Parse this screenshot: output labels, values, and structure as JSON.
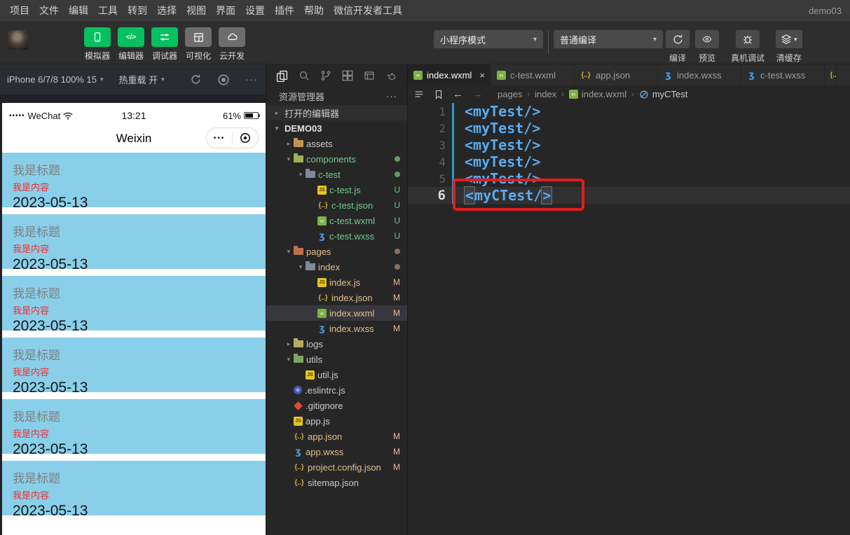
{
  "titlebar": {
    "menus": [
      "项目",
      "文件",
      "编辑",
      "工具",
      "转到",
      "选择",
      "视图",
      "界面",
      "设置",
      "插件",
      "帮助",
      "微信开发者工具"
    ],
    "project": "demo03"
  },
  "toolbar": {
    "mode_buttons": [
      {
        "label": "模拟器",
        "icon": "phone",
        "active": true
      },
      {
        "label": "编辑器",
        "icon": "code",
        "active": true
      },
      {
        "label": "调试器",
        "icon": "sliders",
        "active": true
      },
      {
        "label": "可视化",
        "icon": "grid",
        "active": false
      },
      {
        "label": "云开发",
        "icon": "cloud",
        "active": false
      }
    ],
    "mode_select": "小程序模式",
    "compile_select": "普通编译",
    "actions": [
      {
        "label": "编译",
        "icon": "refresh"
      },
      {
        "label": "预览",
        "icon": "eye"
      },
      {
        "label": "真机调试",
        "icon": "bug"
      },
      {
        "label": "清缓存",
        "icon": "layers",
        "caret": true
      }
    ]
  },
  "simulator": {
    "device": "iPhone 6/7/8 100% 15",
    "hot_reload": "热重载 开",
    "statusbar": {
      "signal": "•••••",
      "carrier": "WeChat",
      "time": "13:21",
      "battery": "61%"
    },
    "nav_title": "Weixin",
    "capsule_dots": "•••",
    "cards": [
      {
        "title": "我是标题",
        "content": "我是内容",
        "date": "2023-05-13"
      },
      {
        "title": "我是标题",
        "content": "我是内容",
        "date": "2023-05-13"
      },
      {
        "title": "我是标题",
        "content": "我是内容",
        "date": "2023-05-13"
      },
      {
        "title": "我是标题",
        "content": "我是内容",
        "date": "2023-05-13"
      },
      {
        "title": "我是标题",
        "content": "我是内容",
        "date": "2023-05-13"
      },
      {
        "title": "我是标题",
        "content": "我是内容",
        "date": "2023-05-13"
      }
    ]
  },
  "explorer": {
    "title": "资源管理器",
    "more_label": "···",
    "activity_icons": [
      "files",
      "search",
      "branch",
      "extensions",
      "package",
      "teapot"
    ],
    "tree": [
      {
        "label": "打开的编辑器",
        "indent": 0,
        "chevron": "right",
        "section": true
      },
      {
        "label": "DEMO03",
        "indent": 0,
        "chevron": "down",
        "bold": true
      },
      {
        "label": "assets",
        "indent": 1,
        "chevron": "right",
        "icon": "folder",
        "folder_color": "#c09553"
      },
      {
        "label": "components",
        "indent": 1,
        "chevron": "down",
        "icon": "folder",
        "folder_color": "#9eb156",
        "color": "untracked",
        "badge": "dot"
      },
      {
        "label": "c-test",
        "indent": 2,
        "chevron": "down",
        "icon": "folder",
        "folder_color": "#7d8a97",
        "color": "untracked",
        "badge": "dot"
      },
      {
        "label": "c-test.js",
        "indent": 3,
        "icon": "js",
        "color": "untracked",
        "badge": "U"
      },
      {
        "label": "c-test.json",
        "indent": 3,
        "icon": "json",
        "color": "untracked",
        "badge": "U"
      },
      {
        "label": "c-test.wxml",
        "indent": 3,
        "icon": "wxml",
        "color": "untracked",
        "badge": "U"
      },
      {
        "label": "c-test.wxss",
        "indent": 3,
        "icon": "wxss",
        "color": "untracked",
        "badge": "U"
      },
      {
        "label": "pages",
        "indent": 1,
        "chevron": "down",
        "icon": "folder",
        "folder_color": "#c0704f",
        "color": "modified",
        "badge": "dot"
      },
      {
        "label": "index",
        "indent": 2,
        "chevron": "down",
        "icon": "folder",
        "folder_color": "#7d8a97",
        "color": "modified",
        "badge": "dot"
      },
      {
        "label": "index.js",
        "indent": 3,
        "icon": "js",
        "color": "modified",
        "badge": "M"
      },
      {
        "label": "index.json",
        "indent": 3,
        "icon": "json",
        "color": "modified",
        "badge": "M"
      },
      {
        "label": "index.wxml",
        "indent": 3,
        "icon": "wxml",
        "color": "modified",
        "badge": "M",
        "selected": true
      },
      {
        "label": "index.wxss",
        "indent": 3,
        "icon": "wxss",
        "color": "modified",
        "badge": "M"
      },
      {
        "label": "logs",
        "indent": 1,
        "chevron": "right",
        "icon": "folder",
        "folder_color": "#b3ae62"
      },
      {
        "label": "utils",
        "indent": 1,
        "chevron": "down",
        "icon": "folder",
        "folder_color": "#7fa45f"
      },
      {
        "label": "util.js",
        "indent": 2,
        "icon": "js"
      },
      {
        "label": ".eslintrc.js",
        "indent": 1,
        "icon": "eslint"
      },
      {
        "label": ".gitignore",
        "indent": 1,
        "icon": "git"
      },
      {
        "label": "app.js",
        "indent": 1,
        "icon": "js"
      },
      {
        "label": "app.json",
        "indent": 1,
        "icon": "json",
        "color": "modified",
        "badge": "M"
      },
      {
        "label": "app.wxss",
        "indent": 1,
        "icon": "wxss",
        "color": "modified",
        "badge": "M"
      },
      {
        "label": "project.config.json",
        "indent": 1,
        "icon": "json",
        "color": "modified",
        "badge": "M"
      },
      {
        "label": "sitemap.json",
        "indent": 1,
        "icon": "json"
      }
    ]
  },
  "editor": {
    "tabs": [
      {
        "label": "index.wxml",
        "icon": "wxml",
        "active": true,
        "close": true
      },
      {
        "label": "c-test.wxml",
        "icon": "wxml"
      },
      {
        "label": "app.json",
        "icon": "json"
      },
      {
        "label": "index.wxss",
        "icon": "wxss"
      },
      {
        "label": "c-test.wxss",
        "icon": "wxss"
      },
      {
        "label": "",
        "icon": "json",
        "partial": true
      }
    ],
    "breadcrumb": [
      {
        "label": "pages"
      },
      {
        "label": "index"
      },
      {
        "label": "index.wxml",
        "icon": "wxml"
      },
      {
        "label": "myCTest",
        "icon": "symbol"
      }
    ],
    "code": {
      "lines": [
        {
          "num": 1,
          "text": "<myTest/>"
        },
        {
          "num": 2,
          "text": "<myTest/>"
        },
        {
          "num": 3,
          "text": "<myTest/>"
        },
        {
          "num": 4,
          "text": "<myTest/>"
        },
        {
          "num": 5,
          "text": "<myTest/>"
        },
        {
          "num": 6,
          "text": "<myCTest/>",
          "current": true,
          "bracket_boxed": true,
          "annotated": true
        }
      ]
    }
  },
  "colors": {
    "accent_green": "#07c160",
    "card_blue": "#89cfea",
    "untracked": "#73c991",
    "modified": "#e2c08d",
    "code_blue": "#58adf2",
    "annotation_red": "#e11d1d",
    "dot_untracked": "#639a63",
    "dot_modified": "#8d6f56"
  }
}
